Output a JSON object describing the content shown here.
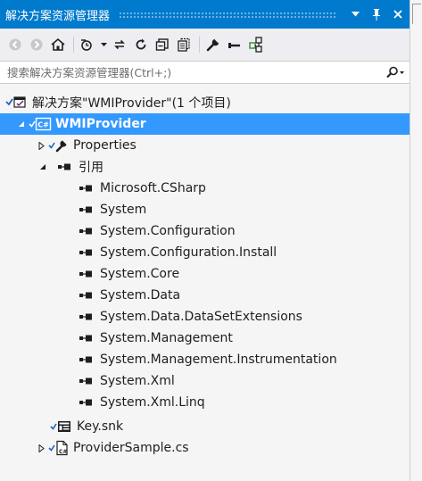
{
  "window": {
    "title": "解决方案资源管理器",
    "dropdown_icon": "▼",
    "pin_icon": "ᚱ",
    "close_icon": "✕"
  },
  "search": {
    "placeholder": "搜索解决方案资源管理器(Ctrl+;)"
  },
  "tree": {
    "solution_label": "解决方案\"WMIProvider\"(1 个项目)",
    "project_label": "WMIProvider",
    "properties_label": "Properties",
    "references_label": "引用",
    "references": [
      "Microsoft.CSharp",
      "System",
      "System.Configuration",
      "System.Configuration.Install",
      "System.Core",
      "System.Data",
      "System.Data.DataSetExtensions",
      "System.Management",
      "System.Management.Instrumentation",
      "System.Xml",
      "System.Xml.Linq"
    ],
    "key_file_label": "Key.snk",
    "source_file_label": "ProviderSample.cs"
  },
  "colors": {
    "accent": "#007acc",
    "selection": "#3399ff"
  }
}
